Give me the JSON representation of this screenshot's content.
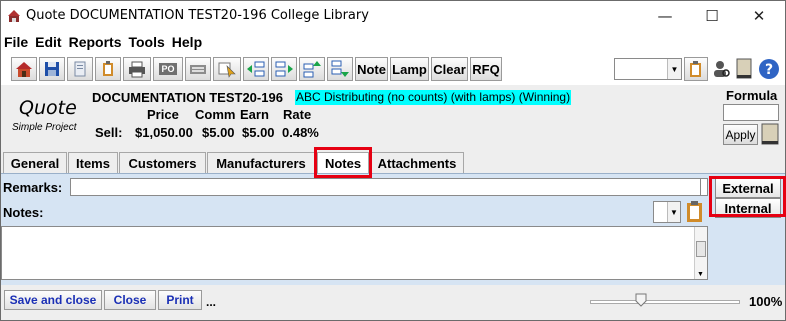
{
  "window": {
    "title": "Quote DOCUMENTATION TEST20-196  College Library",
    "controls": {
      "minimize": "—",
      "maximize": "☐",
      "close": "✕"
    }
  },
  "menu": [
    "File",
    "Edit",
    "Reports",
    "Tools",
    "Help"
  ],
  "toolbar": {
    "icons": [
      "home-icon",
      "save-icon",
      "document-icon",
      "clipboard-icon",
      "printer-icon",
      "po-icon",
      "keyboard-icon",
      "edit-pointer-icon",
      "move-left-icon",
      "move-right-icon",
      "move-up-icon",
      "move-down-icon"
    ],
    "po_label": "PO",
    "text_buttons": [
      "Note",
      "Lamp",
      "Clear",
      "RFQ"
    ],
    "right_icons": [
      "clipboard-icon",
      "user-search-icon",
      "book-icon",
      "help-icon"
    ]
  },
  "header": {
    "type_label": "Quote",
    "type_sub": "Simple Project",
    "quote_name": "DOCUMENTATION TEST20-196",
    "status_text": "ABC Distributing (no counts)  (with lamps)  (Winning)",
    "columns": [
      "Price",
      "Comm",
      "Earn",
      "Rate"
    ],
    "row_label": "Sell:",
    "values": [
      "$1,050.00",
      "$5.00",
      "$5.00",
      "0.48%"
    ],
    "formula_label": "Formula",
    "apply_label": "Apply"
  },
  "tabs": [
    "General",
    "Items",
    "Customers",
    "Manufacturers",
    "Notes",
    "Attachments"
  ],
  "active_tab": "Notes",
  "notes_panel": {
    "remarks_label": "Remarks:",
    "remarks_value": "",
    "notes_label": "Notes:",
    "notes_value": "",
    "side_tabs": [
      "External",
      "Internal"
    ]
  },
  "bottom": {
    "buttons": [
      "Save and close",
      "Close",
      "Print"
    ],
    "ellipsis": "...",
    "zoom": "100%"
  },
  "colors": {
    "status_highlight": "#00ffff",
    "panel_bg": "#d6e4f3",
    "callout_red": "#e60012",
    "button_text_blue": "#1a2fb5"
  }
}
